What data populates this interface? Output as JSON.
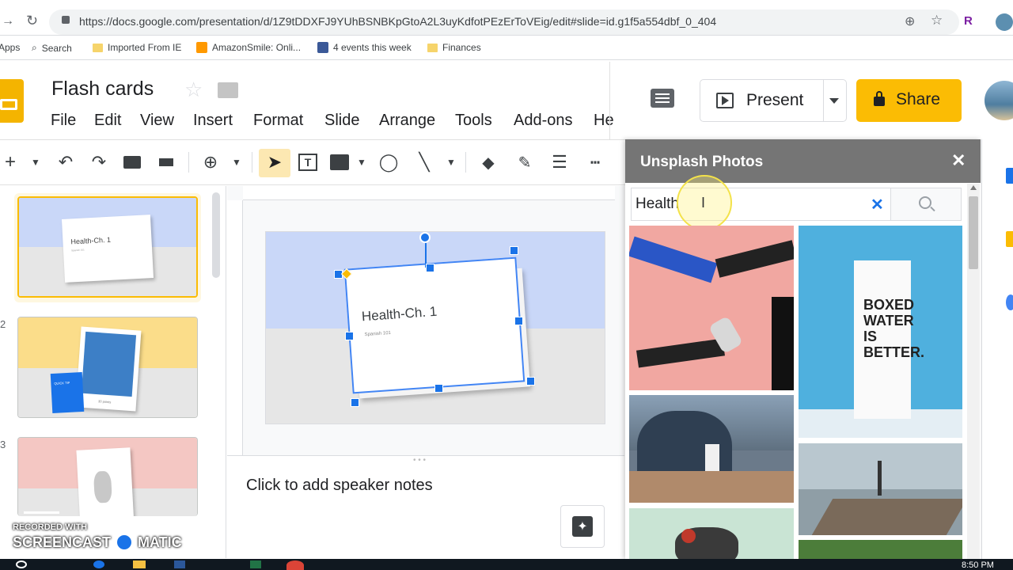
{
  "browser": {
    "url": "https://docs.google.com/presentation/d/1Z9tDDXFJ9YUhBSNBKpGtoA2L3uyKdfotPEzErToVEig/edit#slide=id.g1f5a554dbf_0_404",
    "profile_initial": "R",
    "bookmarks": [
      {
        "label": "Apps"
      },
      {
        "label": "Search"
      },
      {
        "label": "Imported From IE"
      },
      {
        "label": "AmazonSmile: Onli..."
      },
      {
        "label": "4 events this week"
      },
      {
        "label": "Finances"
      }
    ]
  },
  "doc": {
    "title": "Flash cards",
    "menu": [
      "File",
      "Edit",
      "View",
      "Insert",
      "Format",
      "Slide",
      "Arrange",
      "Tools",
      "Add-ons",
      "He"
    ],
    "present_label": "Present",
    "share_label": "Share"
  },
  "filmstrip": {
    "slides": [
      {
        "number": "",
        "card_title": "Health-Ch. 1",
        "card_sub": "Spanish 101",
        "bg_top": "#c9d7f8",
        "bg_bottom": "#e6e6e6"
      },
      {
        "number": "2",
        "card_text": "30 points",
        "badge_text": "QUICK TIP",
        "bg_top": "#fbdd8a",
        "bg_bottom": "#e6e6e6"
      },
      {
        "number": "3",
        "bg_top": "#f4c7c3",
        "bg_bottom": "#e6e6e6"
      }
    ]
  },
  "slide": {
    "card_title": "Health-Ch. 1",
    "card_sub": "Spanish 101",
    "bg_top": "#c9d7f8",
    "bg_bottom": "#e6e6e6"
  },
  "notes": {
    "placeholder": "Click to add speaker notes"
  },
  "panel": {
    "title": "Unsplash Photos",
    "search_value": "Health",
    "photos": [
      {
        "name": "photo-pink-handshake",
        "color": "#f1a7a1"
      },
      {
        "name": "photo-boxed-water",
        "color": "#4fb0de",
        "text": [
          "BOXED",
          "WATER",
          "IS",
          "BETTER."
        ]
      },
      {
        "name": "photo-mountain-drink",
        "color": "#6b7a8a"
      },
      {
        "name": "photo-beach-yoga",
        "color": "#b9c7cf"
      },
      {
        "name": "photo-fruit-heart",
        "color": "#c9e4d4"
      },
      {
        "name": "photo-greens",
        "color": "#4c7d3a"
      }
    ]
  },
  "watermark": {
    "line1": "RECORDED WITH",
    "line2": "SCREENCAST",
    "line3": "MATIC"
  },
  "taskbar": {
    "clock": "8:50 PM"
  },
  "colors": {
    "accent_blue": "#1a73e8",
    "share_yellow": "#fbbc04",
    "panel_header": "#757575",
    "selection_yellow": "#fbbc04"
  }
}
